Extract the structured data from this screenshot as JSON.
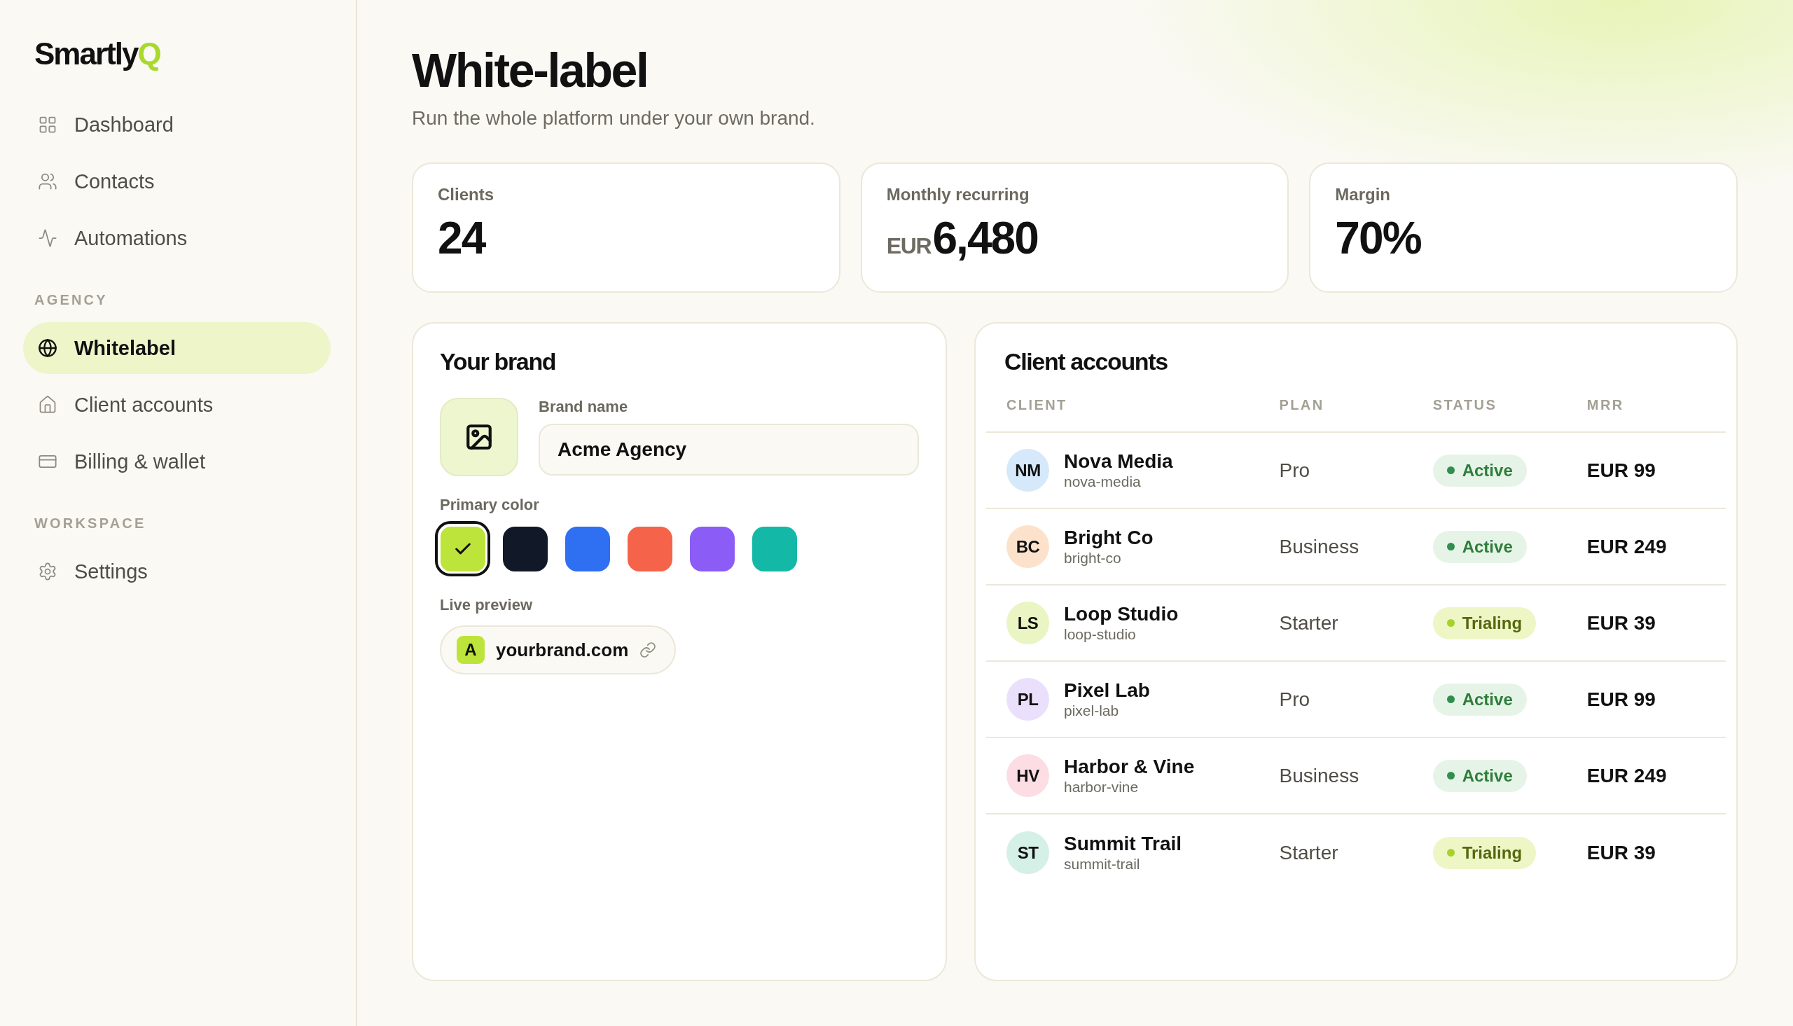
{
  "sidebar": {
    "logo": {
      "text": "Smartly",
      "accent": "Q"
    },
    "sections": [
      {
        "items": [
          {
            "label": "Dashboard",
            "selected": false
          },
          {
            "label": "Contacts",
            "selected": false
          },
          {
            "label": "Automations",
            "selected": false
          }
        ]
      },
      {
        "title": "AGENCY",
        "items": [
          {
            "label": "Whitelabel",
            "selected": true
          },
          {
            "label": "Client accounts",
            "selected": false
          },
          {
            "label": "Billing & wallet",
            "selected": false
          }
        ]
      },
      {
        "title": "WORKSPACE",
        "items": [
          {
            "label": "Settings",
            "selected": false
          }
        ]
      }
    ]
  },
  "header": {
    "title": "White-label",
    "subtitle": "Run the whole platform under your own brand."
  },
  "stats": [
    {
      "label": "Clients",
      "value": "24"
    },
    {
      "label": "Monthly recurring",
      "prefix": "EUR",
      "value": "6,480"
    },
    {
      "label": "Margin",
      "value": "70%"
    }
  ],
  "brand": {
    "title": "Your brand",
    "name_label": "Brand name",
    "name_value": "Acme Agency",
    "color_label": "Primary color",
    "colors": [
      {
        "color": "#bde43a",
        "selected": true
      },
      {
        "color": "#111827",
        "selected": false
      },
      {
        "color": "#2f6ff2",
        "selected": false
      },
      {
        "color": "#f4634a",
        "selected": false
      },
      {
        "color": "#8b5cf6",
        "selected": false
      },
      {
        "color": "#14b8a6",
        "selected": false
      }
    ],
    "preview_label": "Live preview",
    "preview_initial": "A",
    "preview_domain": "yourbrand.com"
  },
  "client_accounts": {
    "title": "Client accounts",
    "columns": [
      "CLIENT",
      "PLAN",
      "STATUS",
      "MRR"
    ],
    "rows": [
      {
        "initials": "NM",
        "color": "#d5e9fb",
        "name": "Nova Media",
        "slug": "nova-media",
        "plan": "Pro",
        "status": {
          "label": "Active",
          "kind": "active"
        },
        "mrr": "EUR 99"
      },
      {
        "initials": "BC",
        "color": "#fce2cb",
        "name": "Bright Co",
        "slug": "bright-co",
        "plan": "Business",
        "status": {
          "label": "Active",
          "kind": "active"
        },
        "mrr": "EUR 249"
      },
      {
        "initials": "LS",
        "color": "#e9f5c2",
        "name": "Loop Studio",
        "slug": "loop-studio",
        "plan": "Starter",
        "status": {
          "label": "Trialing",
          "kind": "trialing"
        },
        "mrr": "EUR 39"
      },
      {
        "initials": "PL",
        "color": "#ebe0fb",
        "name": "Pixel Lab",
        "slug": "pixel-lab",
        "plan": "Pro",
        "status": {
          "label": "Active",
          "kind": "active"
        },
        "mrr": "EUR 99"
      },
      {
        "initials": "HV",
        "color": "#fcdde4",
        "name": "Harbor & Vine",
        "slug": "harbor-vine",
        "plan": "Business",
        "status": {
          "label": "Active",
          "kind": "active"
        },
        "mrr": "EUR 249"
      },
      {
        "initials": "ST",
        "color": "#d4f0e7",
        "name": "Summit Trail",
        "slug": "summit-trail",
        "plan": "Starter",
        "status": {
          "label": "Trialing",
          "kind": "trialing"
        },
        "mrr": "EUR 39"
      }
    ]
  }
}
